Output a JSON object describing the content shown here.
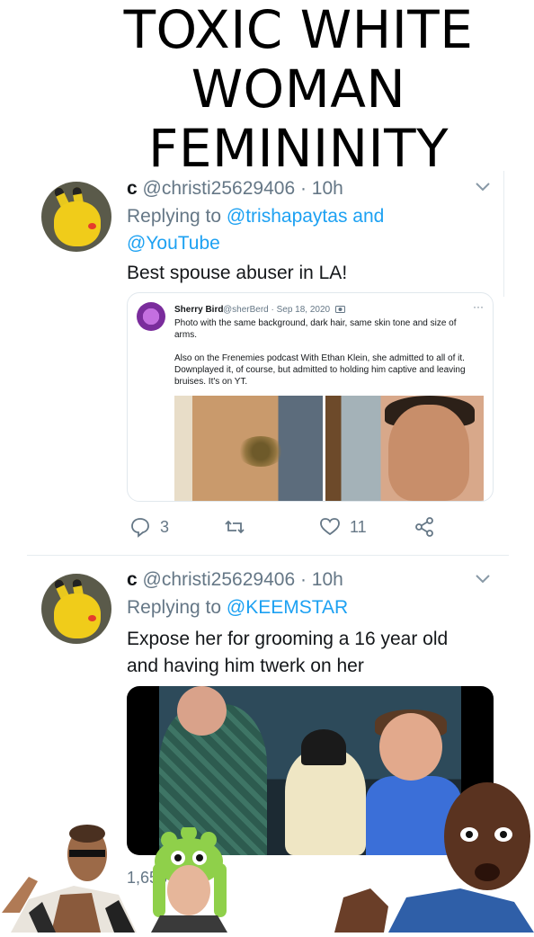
{
  "meme_title": {
    "line1": "TOXIC WHITE",
    "line2": "WOMAN",
    "line3": "FEMININITY"
  },
  "tweet1": {
    "name": "c",
    "handle_time": "@christi25629406 · 10h",
    "replying_prefix": "Replying to",
    "reply_to_1": "@trishapaytas",
    "reply_and": "and",
    "reply_to_2": "@YouTube",
    "text": "Best spouse abuser in LA!",
    "quote": {
      "name": "Sherry Bird",
      "meta": "@sherBerd · Sep 18, 2020",
      "text1": "Photo with the same background, dark hair, same skin tone and size of arms.",
      "text2": "Also on the Frenemies podcast With Ethan Klein, she admitted to all of it. Downplayed it, of course, but admitted to holding him captive and leaving bruises. It's on YT."
    },
    "reply_count": "3",
    "like_count": "11"
  },
  "tweet2": {
    "name": "c",
    "handle_time": "@christi25629406 · 10h",
    "replying_prefix": "Replying to",
    "reply_to_1": "@KEEMSTAR",
    "text_line1": "Expose her for grooming a 16 year old",
    "text_line2": "and having him twerk on her",
    "views": "1,656"
  },
  "colors": {
    "link": "#1da1f2",
    "secondary": "#657786"
  },
  "icons": [
    "chevron-down-icon",
    "reply-icon",
    "retweet-icon",
    "like-icon",
    "share-icon",
    "camera-icon",
    "more-icon"
  ]
}
